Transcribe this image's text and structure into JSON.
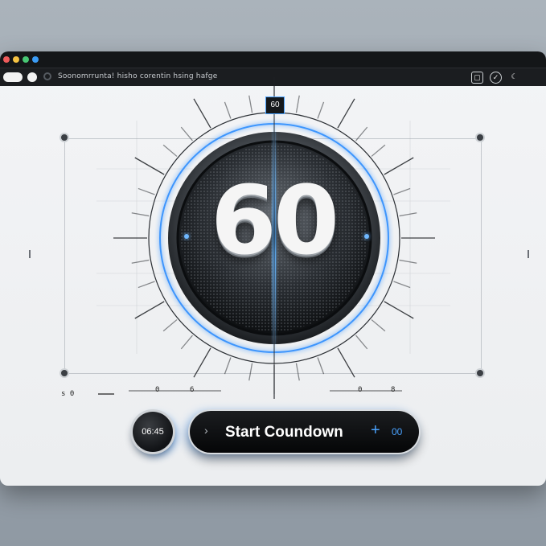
{
  "window": {
    "traffic_lights": [
      "#ef5b5b",
      "#f5c242",
      "#48c774",
      "#3b9cf5"
    ],
    "address_text": "Soonomrrunta! hisho corentin hsing hafge",
    "toolbar_icons": [
      "image-icon",
      "check-circle-icon",
      "moon-icon"
    ]
  },
  "dial": {
    "value": "60",
    "badge": "60",
    "accent_color": "#2a8cff"
  },
  "scale": {
    "left_label": "s   0",
    "mid_label_1": "0",
    "mid_label_2": "6",
    "right_label_1": "0",
    "right_label_2": "8"
  },
  "controls": {
    "timer_chip": "06:45",
    "start_button_label": "Start Coundown",
    "start_button_chevron": "›",
    "start_button_plus": "+",
    "start_button_count": "00"
  }
}
